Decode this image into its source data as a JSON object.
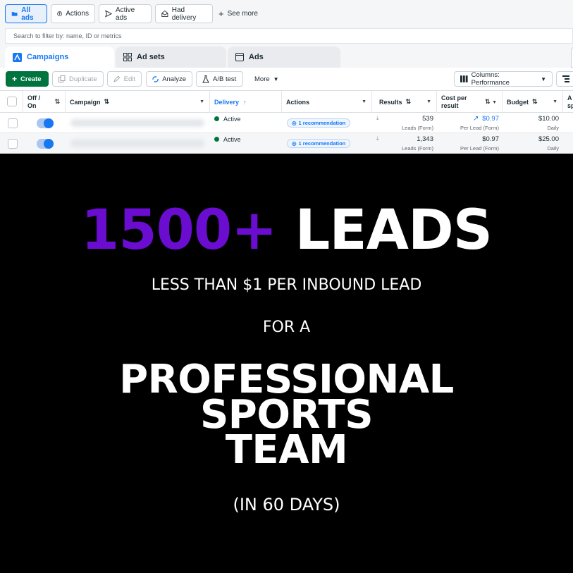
{
  "filters": {
    "all_ads": "All ads",
    "actions": "Actions",
    "active_ads": "Active ads",
    "had_delivery": "Had delivery",
    "see_more": "See more"
  },
  "search": {
    "placeholder": "Search to filter by: name, ID or metrics"
  },
  "tabs": [
    {
      "label": "Campaigns",
      "icon": "campaign-icon"
    },
    {
      "label": "Ad sets",
      "icon": "grid-icon"
    },
    {
      "label": "Ads",
      "icon": "ad-icon"
    }
  ],
  "toolbar": {
    "create": "Create",
    "duplicate": "Duplicate",
    "edit": "Edit",
    "analyze": "Analyze",
    "ab_test": "A/B test",
    "more": "More",
    "columns": "Columns: Performance"
  },
  "table": {
    "headers": {
      "off_on": "Off / On",
      "campaign": "Campaign",
      "delivery": "Delivery",
      "actions": "Actions",
      "results": "Results",
      "cost_per_result": "Cost per result",
      "budget": "Budget",
      "amount_spent_partial": "A sp"
    },
    "rows": [
      {
        "delivery": "Active",
        "recommendation": "1 recommendation",
        "results": "539",
        "results_sub": "Leads (Form)",
        "cost": "$0.97",
        "cost_sub": "Per Lead (Form)",
        "budget": "$10.00",
        "budget_sub": "Daily"
      },
      {
        "delivery": "Active",
        "recommendation": "1 recommendation",
        "results": "1,343",
        "results_sub": "Leads (Form)",
        "cost": "$0.97",
        "cost_sub": "Per Lead (Form)",
        "budget": "$25.00",
        "budget_sub": "Daily"
      }
    ]
  },
  "promo": {
    "headline_number": "1500+",
    "headline_word": "LEADS",
    "line1": "LESS THAN $1 PER INBOUND LEAD",
    "line2": "FOR A",
    "big1": "PROFESSIONAL",
    "big2": "SPORTS",
    "big3": "TEAM",
    "line3": "(IN 60 DAYS)"
  },
  "colors": {
    "accent_purple": "#6a0dd0",
    "brand_blue": "#1877f2",
    "create_green": "#00743f"
  }
}
